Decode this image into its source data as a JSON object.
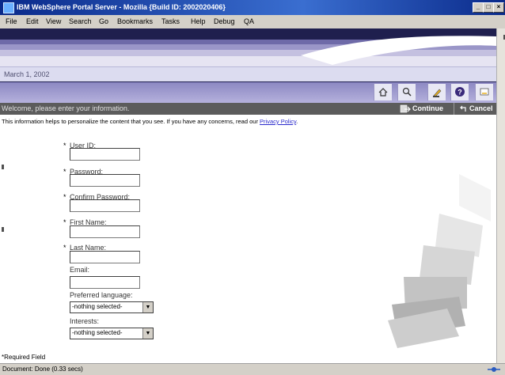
{
  "window": {
    "title": "IBM WebSphere Portal Server - Mozilla {Build ID: 2002020406}",
    "controls": [
      "_",
      "□",
      "×"
    ]
  },
  "menu": [
    "File",
    "Edit",
    "View",
    "Search",
    "Go",
    "Bookmarks",
    "Tasks",
    "Help",
    "Debug",
    "QA"
  ],
  "portal": {
    "date": "March 1, 2002",
    "toolbar_icons": [
      "home-icon",
      "search-icon",
      "edit-icon",
      "help-icon",
      "minimize-icon"
    ],
    "welcome": "Welcome, please enter your information.",
    "continue_label": "Continue",
    "cancel_label": "Cancel"
  },
  "intro": {
    "text": "This information helps to personalize the content that you see. If you have any concerns, read our ",
    "link": "Privacy Policy",
    "end": "."
  },
  "form": {
    "fields": [
      {
        "label": "User ID:",
        "required": true,
        "value": ""
      },
      {
        "label": "Password:",
        "required": true,
        "value": ""
      },
      {
        "label": "Confirm Password:",
        "required": true,
        "value": ""
      },
      {
        "label": "First Name:",
        "required": true,
        "value": ""
      },
      {
        "label": "Last Name:",
        "required": true,
        "value": ""
      },
      {
        "label": "Email:",
        "required": false,
        "value": ""
      }
    ],
    "language_label": "Preferred language:",
    "language_value": "-nothing selected-",
    "interests_label": "Interests:",
    "interests_value": "-nothing selected-",
    "required_note": "*Required Field",
    "asterisk": "*"
  },
  "status": "Document: Done (0.33 secs)"
}
